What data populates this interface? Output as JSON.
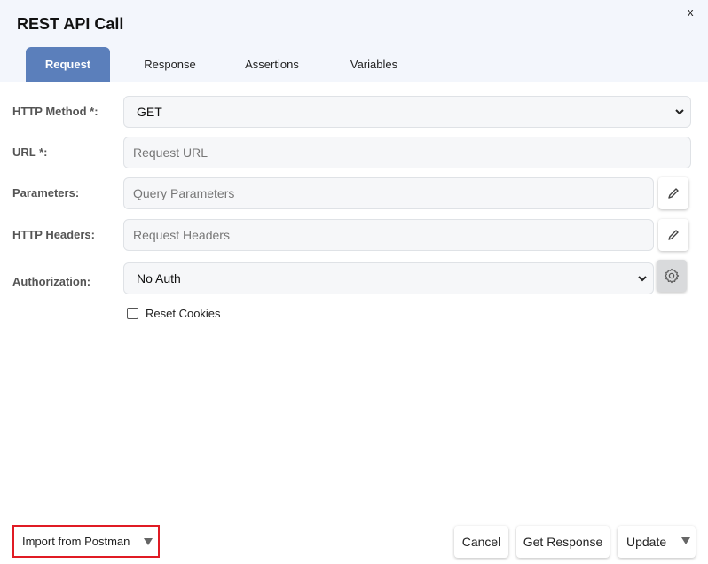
{
  "dialog": {
    "title": "REST API Call",
    "close_label": "x"
  },
  "tabs": [
    {
      "label": "Request",
      "active": true
    },
    {
      "label": "Response"
    },
    {
      "label": "Assertions"
    },
    {
      "label": "Variables"
    }
  ],
  "form": {
    "http_method": {
      "label": "HTTP Method *:",
      "value": "GET"
    },
    "url": {
      "label": "URL *:",
      "placeholder": "Request URL"
    },
    "parameters": {
      "label": "Parameters:",
      "placeholder": "Query Parameters"
    },
    "http_headers": {
      "label": "HTTP Headers:",
      "placeholder": "Request Headers"
    },
    "authorization": {
      "label": "Authorization:",
      "value": "No Auth"
    },
    "reset_cookies": {
      "label": "Reset Cookies",
      "checked": false
    }
  },
  "footer": {
    "import_label": "Import from Postman",
    "cancel_label": "Cancel",
    "get_response_label": "Get Response",
    "update_label": "Update"
  },
  "colors": {
    "accent": "#5b7fbb",
    "highlight": "#e01b24"
  },
  "icons": [
    "pencil-icon",
    "gear-icon",
    "chevron-down-icon",
    "caret-down-icon"
  ]
}
